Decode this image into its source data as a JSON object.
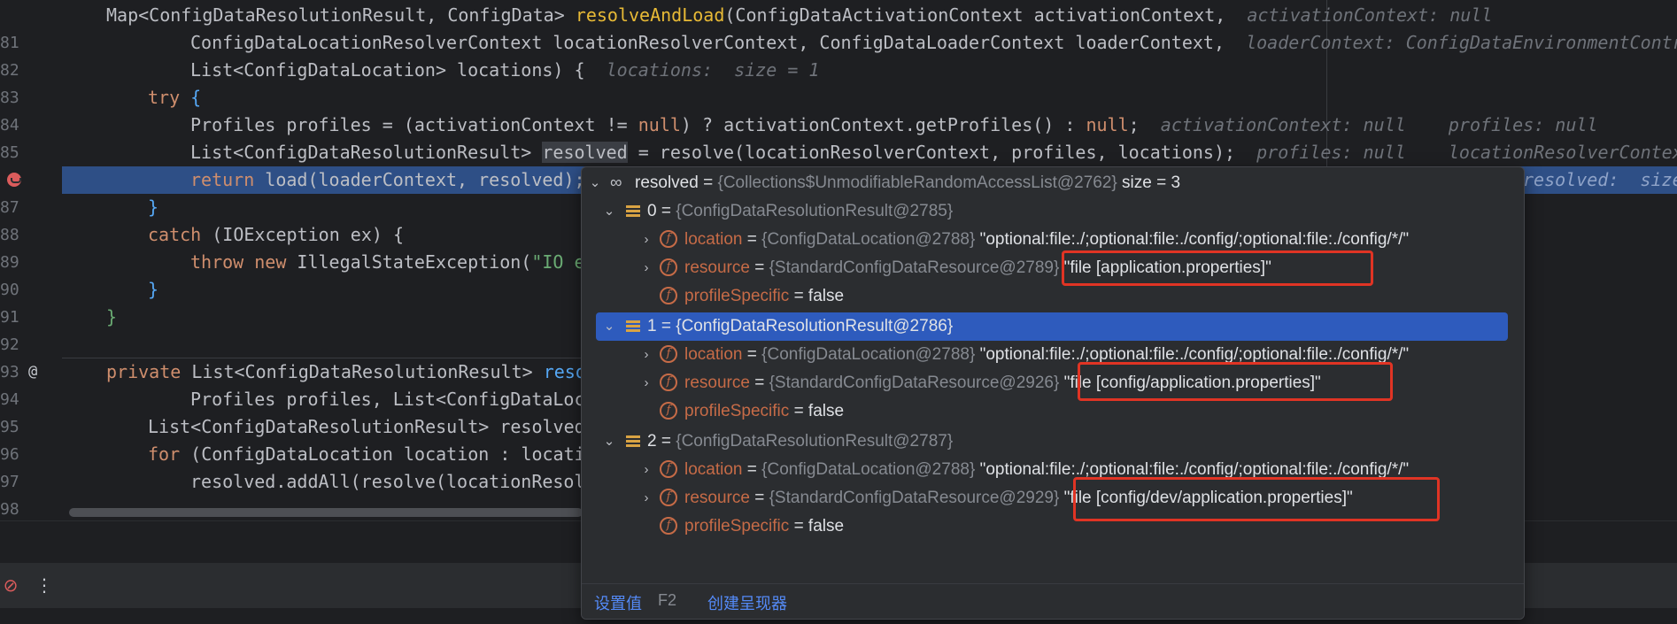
{
  "editor": {
    "lines": [
      {
        "num": "",
        "marker": ""
      },
      {
        "num": "81",
        "marker": ""
      },
      {
        "num": "82",
        "marker": ""
      },
      {
        "num": "83",
        "marker": ""
      },
      {
        "num": "84",
        "marker": ""
      },
      {
        "num": "85",
        "marker": ""
      },
      {
        "num": "",
        "marker": "breakpoint"
      },
      {
        "num": "87",
        "marker": ""
      },
      {
        "num": "88",
        "marker": ""
      },
      {
        "num": "89",
        "marker": ""
      },
      {
        "num": "90",
        "marker": ""
      },
      {
        "num": "91",
        "marker": ""
      },
      {
        "num": "92",
        "marker": ""
      },
      {
        "num": "93",
        "marker": "@"
      },
      {
        "num": "94",
        "marker": ""
      },
      {
        "num": "95",
        "marker": ""
      },
      {
        "num": "96",
        "marker": ""
      },
      {
        "num": "97",
        "marker": ""
      },
      {
        "num": "98",
        "marker": ""
      }
    ],
    "code": {
      "l80": "Map<ConfigDataResolutionResult, ConfigData> ",
      "l80_fn": "resolveAndLoad",
      "l80_rest": "(ConfigDataActivationContext activationContext,",
      "l80_hint": "activationContext: null",
      "l81": "ConfigDataLocationResolverContext locationResolverContext, ConfigDataLoaderContext loaderContext,",
      "l81_hint": "loaderContext: ConfigDataEnvironmentContri",
      "l82": "List<ConfigDataLocation> locations) {",
      "l82_hint": "locations:  size = 1",
      "l83_kw": "try",
      "l83_rest": " {",
      "l84": "Profiles profiles = (activationContext != ",
      "l84_null": "null",
      "l84_rest": ") ? activationContext.getProfiles() : ",
      "l84_null2": "null",
      "l84_end": ";",
      "l84_hint": "activationContext: null    profiles: null",
      "l85_a": "List<ConfigDataResolutionResult> ",
      "l85_sel": "resolved",
      "l85_b": " = resolve(locationResolverContext, profiles, locations);",
      "l85_hint": "profiles: null    locationResolverContext",
      "l86_kw": "return",
      "l86_rest": " load(loaderContext, resolved);",
      "l86_hint": "resolved:  size",
      "l87": "}",
      "l88_kw": "catch",
      "l88_rest": " (IOException ex) {",
      "l89_kw": "throw new",
      "l89_rest": " IllegalStateException(",
      "l89_str": "\"IO e",
      "l90": "}",
      "l91": "}",
      "l93_kw": "private",
      "l93_rest": " List<ConfigDataResolutionResult> ",
      "l93_fn": "reso",
      "l94": "Profiles profiles, List<ConfigDataLoc",
      "l95": "List<ConfigDataResolutionResult> resolved",
      "l96_kw": "for",
      "l96_rest": " (ConfigDataLocation location : locati",
      "l97": "resolved.addAll(resolve(locationResol"
    }
  },
  "popup": {
    "root": {
      "name": "resolved",
      "type": "{Collections$UnmodifiableRandomAccessList@2762}",
      "size": "size = 3"
    },
    "items": [
      {
        "index": "0",
        "type": "{ConfigDataResolutionResult@2785}",
        "location_type": "{ConfigDataLocation@2788}",
        "location_value": "\"optional:file:./;optional:file:./config/;optional:file:./config/*/\"",
        "resource_type": "{StandardConfigDataResource@2789}",
        "resource_value": "\"file [application.properties]\"",
        "profile_value": "= false"
      },
      {
        "index": "1",
        "type": "{ConfigDataResolutionResult@2786}",
        "location_type": "{ConfigDataLocation@2788}",
        "location_value": "\"optional:file:./;optional:file:./config/;optional:file:./config/*/\"",
        "resource_type": "{StandardConfigDataResource@2926}",
        "resource_value": "\"file [config/application.properties]\"",
        "profile_value": "= false"
      },
      {
        "index": "2",
        "type": "{ConfigDataResolutionResult@2787}",
        "location_type": "{ConfigDataLocation@2788}",
        "location_value": "\"optional:file:./;optional:file:./config/;optional:file:./config/*/\"",
        "resource_type": "{StandardConfigDataResource@2929}",
        "resource_value": "\"file [config/dev/application.properties]\"",
        "profile_value": "= false"
      }
    ],
    "field_names": {
      "location": "location",
      "resource": "resource",
      "profile": "profileSpecific",
      "eq": " = "
    },
    "footer": {
      "set_value": "设置值",
      "set_value_key": "F2",
      "create_renderer": "创建呈现器"
    }
  }
}
